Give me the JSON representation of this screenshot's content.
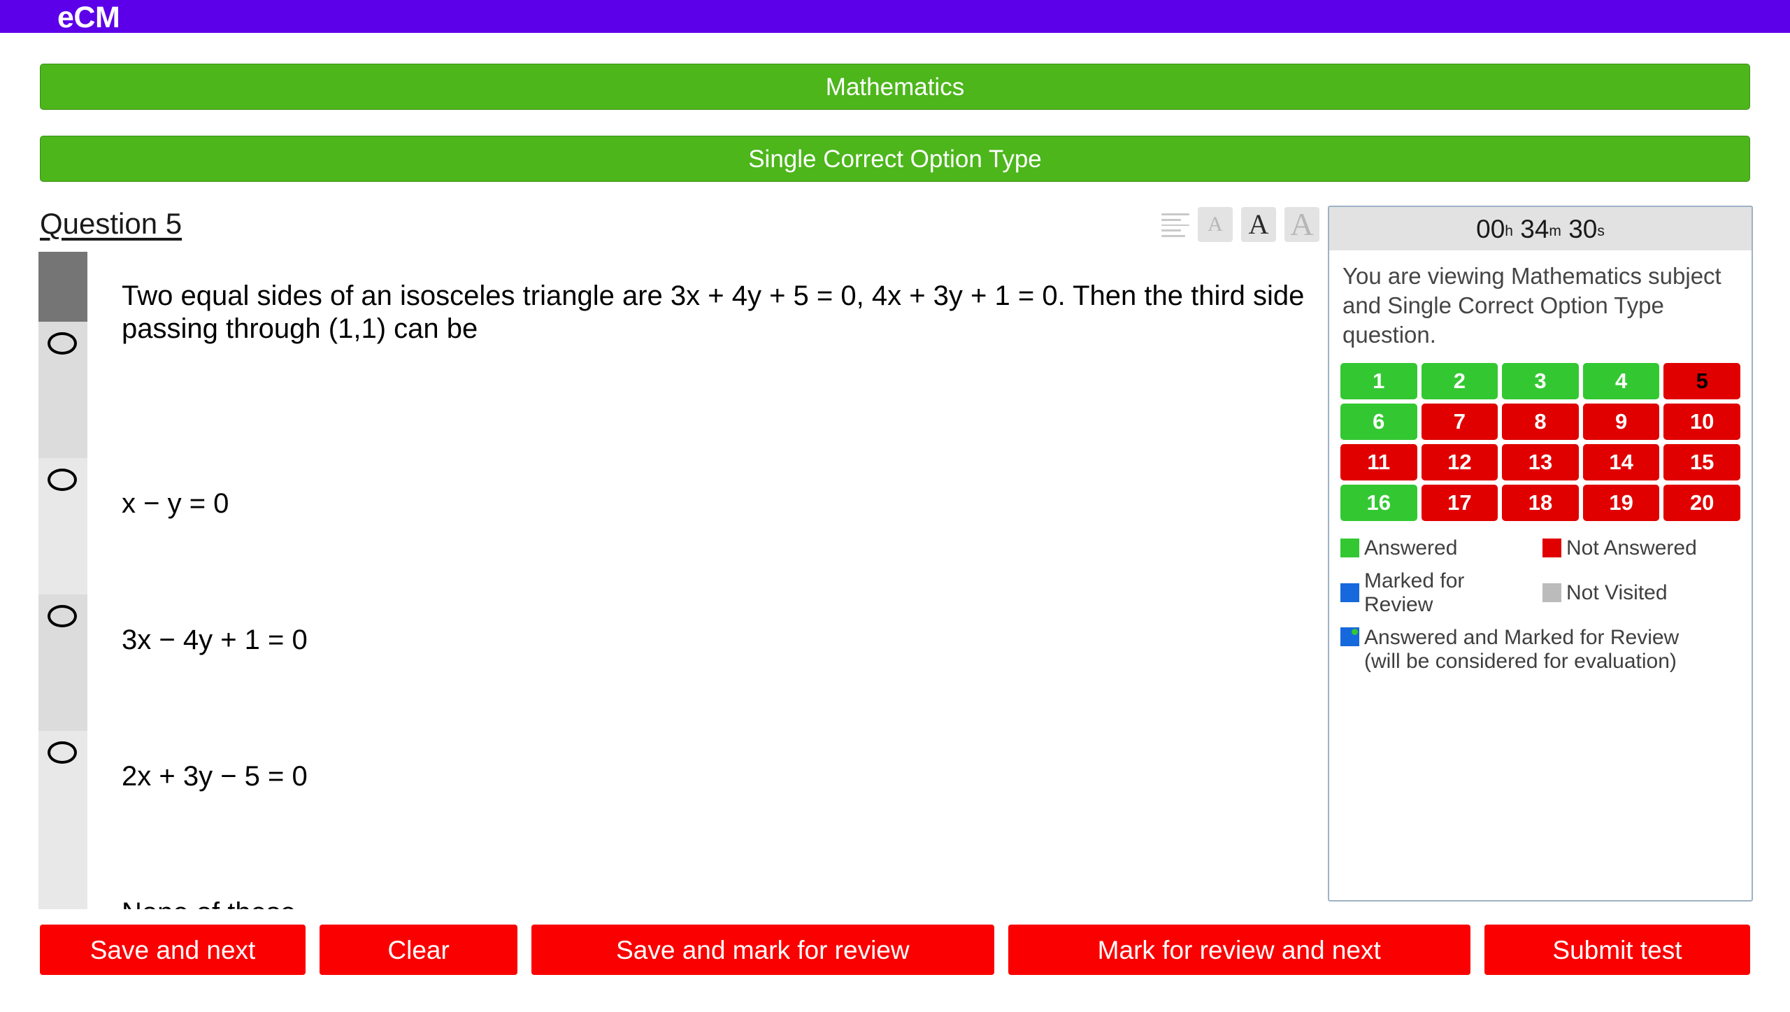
{
  "brand": {
    "name": "eCM"
  },
  "banners": {
    "subject": "Mathematics",
    "question_type": "Single Correct Option Type"
  },
  "question": {
    "title": "Question 5",
    "text": "Two equal sides of an isosceles triangle are 3x + 4y + 5 = 0, 4x + 3y + 1 = 0. Then the third side passing through (1,1) can be",
    "options": [
      {
        "label": "x − y = 0"
      },
      {
        "label": "3x − 4y + 1 = 0"
      },
      {
        "label": "2x + 3y − 5 = 0"
      },
      {
        "label": "None of these"
      }
    ]
  },
  "font_controls": {
    "lines_icon": "text-lines-icon",
    "small_label": "A",
    "medium_label": "A",
    "large_label": "A",
    "active": "medium"
  },
  "timer": {
    "hours": "00",
    "hours_unit": "h",
    "minutes": "34",
    "minutes_unit": "m",
    "seconds": "30",
    "seconds_unit": "s"
  },
  "side_panel": {
    "info": "You are viewing Mathematics subject and Single Correct Option Type question.",
    "palette": [
      {
        "number": "1",
        "state": "answered"
      },
      {
        "number": "2",
        "state": "answered"
      },
      {
        "number": "3",
        "state": "answered"
      },
      {
        "number": "4",
        "state": "answered"
      },
      {
        "number": "5",
        "state": "notanswered",
        "current": true
      },
      {
        "number": "6",
        "state": "answered"
      },
      {
        "number": "7",
        "state": "notanswered"
      },
      {
        "number": "8",
        "state": "notanswered"
      },
      {
        "number": "9",
        "state": "notanswered"
      },
      {
        "number": "10",
        "state": "notanswered"
      },
      {
        "number": "11",
        "state": "notanswered"
      },
      {
        "number": "12",
        "state": "notanswered"
      },
      {
        "number": "13",
        "state": "notanswered"
      },
      {
        "number": "14",
        "state": "notanswered"
      },
      {
        "number": "15",
        "state": "notanswered"
      },
      {
        "number": "16",
        "state": "answered"
      },
      {
        "number": "17",
        "state": "notanswered"
      },
      {
        "number": "18",
        "state": "notanswered"
      },
      {
        "number": "19",
        "state": "notanswered"
      },
      {
        "number": "20",
        "state": "notanswered"
      }
    ],
    "legend": {
      "answered": "Answered",
      "not_answered": "Not Answered",
      "marked_for_review": "Marked for Review",
      "not_visited": "Not Visited",
      "answered_and_marked": "Answered and Marked for Review\n (will be considered for evaluation)"
    }
  },
  "actions": {
    "save_and_next": "Save and next",
    "clear": "Clear",
    "save_and_mark": "Save and mark for review",
    "mark_and_next": "Mark for review and next",
    "submit_test": "Submit test"
  },
  "colors": {
    "brand_purple": "#5B00E8",
    "banner_green": "#4CB61B",
    "answered_green": "#33C832",
    "not_answered_red": "#E00000",
    "marked_blue": "#1668DD",
    "not_visited_gray": "#BBBBBB",
    "action_red": "#FB0000",
    "panel_border": "#9DB2C6"
  }
}
